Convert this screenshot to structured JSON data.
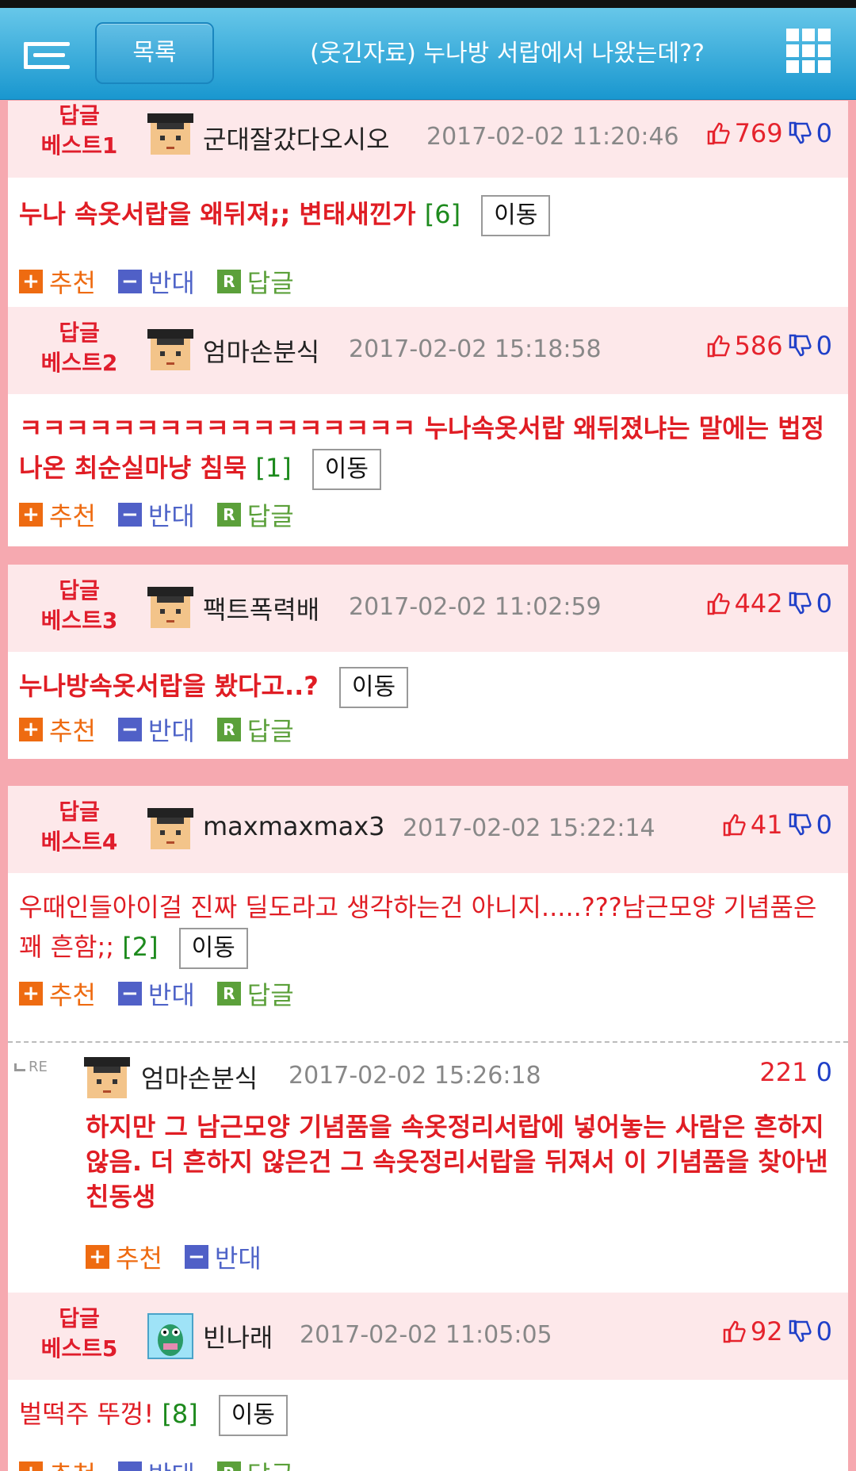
{
  "header": {
    "list_label": "목록",
    "title": "(웃긴자료) 누나방 서랍에서 나왔는데??",
    "menu_icon": "menu-list-icon",
    "grid_icon": "grid-apps-icon"
  },
  "labels": {
    "recommend": "추천",
    "oppose": "반대",
    "reply": "답글",
    "move": "이동",
    "rank_top": "답글"
  },
  "colors": {
    "header_bg": "#1997cf",
    "rank_red": "#e01d2c",
    "recommend": "#ee6b11",
    "oppose": "#5060c7",
    "reply": "#5ba03a",
    "count_green": "#1d8a1d"
  },
  "comments": [
    {
      "rank": "베스트1",
      "nick": "군대잘갔다오시오",
      "date": "2017-02-02 11:20:46",
      "up": "769",
      "down": "0",
      "text": "누나 속옷서랍을 왜뒤져;; 변태새낀가",
      "count": "[6]"
    },
    {
      "rank": "베스트2",
      "nick": "엄마손분식",
      "date": "2017-02-02 15:18:58",
      "up": "586",
      "down": "0",
      "text": "ㅋㅋㅋㅋㅋㅋㅋㅋㅋㅋㅋㅋㅋㅋㅋㅋㅋ 누나속옷서랍 왜뒤졌냐는 말에는 법정나온 최순실마냥 침묵",
      "count": "[1]"
    },
    {
      "rank": "베스트3",
      "nick": "팩트폭력배",
      "date": "2017-02-02 11:02:59",
      "up": "442",
      "down": "0",
      "text": "누나방속옷서랍을 봤다고..?",
      "count": ""
    },
    {
      "rank": "베스트4",
      "nick": "maxmaxmax3",
      "date": "2017-02-02 15:22:14",
      "up": "41",
      "down": "0",
      "text": "우때인들아이걸 진짜 딜도라고 생각하는건 아니지.....???남근모양 기념품은 꽤 흔함;;",
      "count": "[2]"
    },
    {
      "rank": "베스트5",
      "nick": "빈나래",
      "date": "2017-02-02 11:05:05",
      "up": "92",
      "down": "0",
      "text": "벌떡주 뚜껑!",
      "count": "[8]"
    }
  ],
  "reply": {
    "re_label": "RE",
    "nick": "엄마손분식",
    "date": "2017-02-02 15:26:18",
    "up": "221",
    "down": "0",
    "text": "하지만 그 남근모양 기념품을 속옷정리서랍에 넣어놓는 사람은 흔하지 않음. 더 흔하지 않은건 그 속옷정리서랍을 뒤져서 이 기념품을 찾아낸 친동생"
  }
}
